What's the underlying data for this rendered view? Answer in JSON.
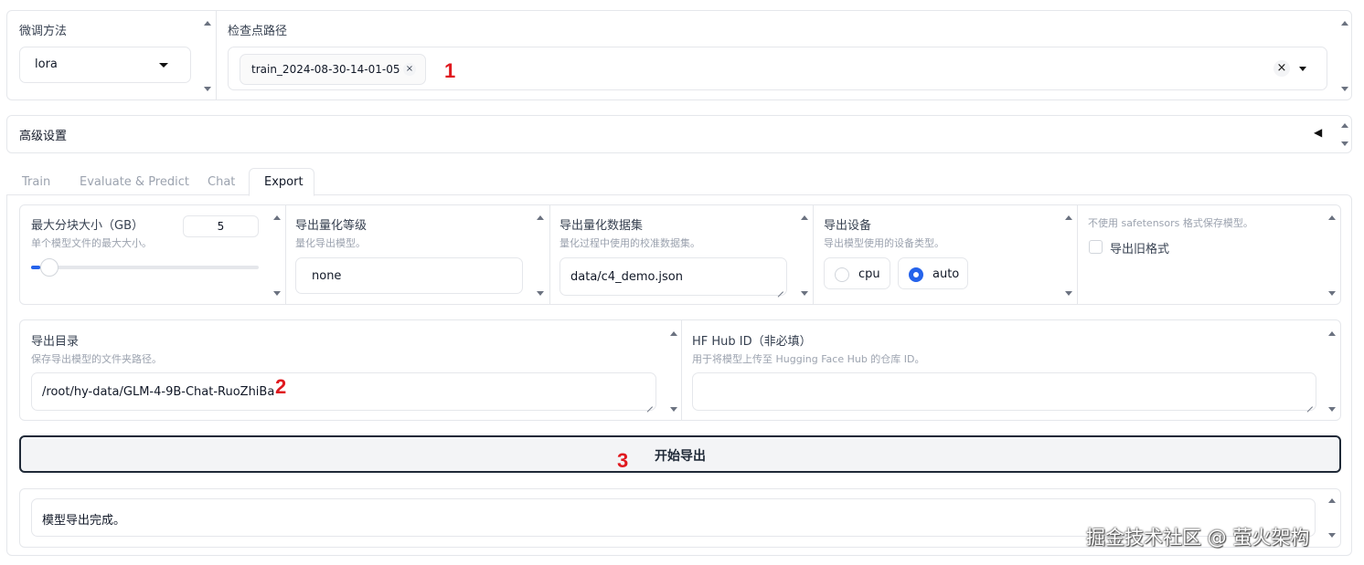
{
  "top": {
    "finetune": {
      "label": "微调方法",
      "value": "lora"
    },
    "checkpoint": {
      "label": "检查点路径",
      "chip": "train_2024-08-30-14-01-05",
      "marker": "1"
    }
  },
  "advanced": {
    "label": "高级设置",
    "toggle_glyph": "◀"
  },
  "tabs": [
    "Train",
    "Evaluate & Predict",
    "Chat",
    "Export"
  ],
  "export": {
    "max_shard": {
      "label": "最大分块大小（GB）",
      "info": "单个模型文件的最大大小。",
      "value": "5",
      "slider_fraction": 0.0
    },
    "quant_bit": {
      "label": "导出量化等级",
      "info": "量化导出模型。",
      "value": "none"
    },
    "quant_dataset": {
      "label": "导出量化数据集",
      "info": "量化过程中使用的校准数据集。",
      "value": "data/c4_demo.json"
    },
    "device": {
      "label": "导出设备",
      "info": "导出模型使用的设备类型。",
      "options": [
        "cpu",
        "auto"
      ],
      "selected": "auto"
    },
    "legacy": {
      "info": "不使用 safetensors 格式保存模型。",
      "label": "导出旧格式",
      "checked": false
    },
    "dir": {
      "label": "导出目录",
      "info": "保存导出模型的文件夹路径。",
      "value": "/root/hy-data/GLM-4-9B-Chat-RuoZhiBa",
      "marker": "2"
    },
    "hub": {
      "label": "HF Hub ID（非必填）",
      "info": "用于将模型上传至 Hugging Face Hub 的仓库 ID。",
      "value": ""
    },
    "start_button": "开始导出",
    "start_marker": "3",
    "output": "模型导出完成。"
  },
  "watermark": "掘金技术社区 @ 萤火架构",
  "colors": {
    "accent": "#2563eb",
    "marker": "#e0191f",
    "border": "#e5e7eb"
  }
}
